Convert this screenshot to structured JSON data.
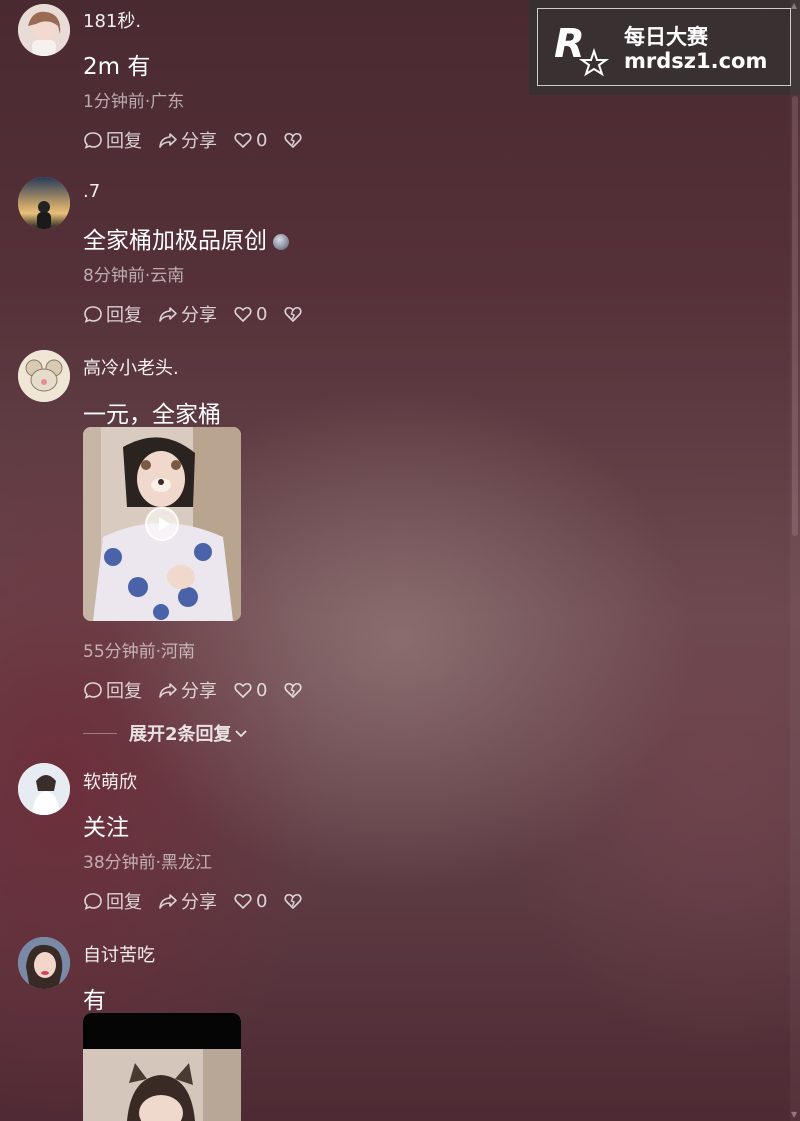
{
  "watermark": {
    "title": "每日大赛",
    "domain": "mrdsz1.com"
  },
  "labels": {
    "reply": "回复",
    "share": "分享"
  },
  "comments": [
    {
      "username": "181秒.",
      "content": "2m 有",
      "meta": "1分钟前·广东",
      "likes": "0"
    },
    {
      "username": ".7",
      "content": "全家桶加极品原创",
      "meta": "8分钟前·云南",
      "likes": "0"
    },
    {
      "username": "高冷小老头.",
      "content": "一元，全家桶",
      "meta": "55分钟前·河南",
      "likes": "0",
      "expand_label": "展开2条回复"
    },
    {
      "username": "软萌欣",
      "content": "关注",
      "meta": "38分钟前·黑龙江",
      "likes": "0"
    },
    {
      "username": "自讨苦吃",
      "content": "有"
    }
  ]
}
